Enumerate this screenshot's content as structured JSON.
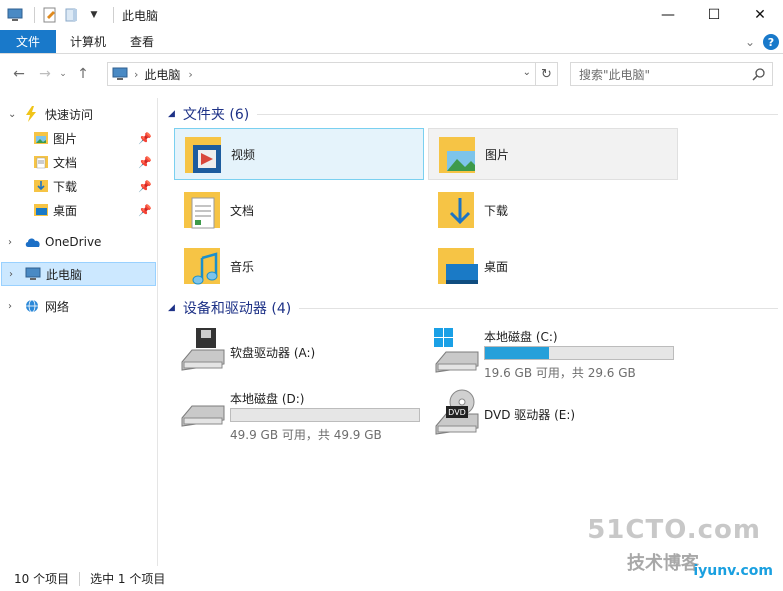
{
  "window": {
    "title": "此电脑",
    "minimize": "—",
    "maximize": "☐",
    "close": "✕"
  },
  "ribbon": {
    "tabs": [
      "文件",
      "计算机",
      "查看"
    ],
    "expand": "⌄",
    "help": "?"
  },
  "address": {
    "location": "此电脑",
    "search_placeholder": "搜索\"此电脑\""
  },
  "sidebar": {
    "quick_access": "快速访问",
    "pinned": [
      "图片",
      "文档",
      "下载",
      "桌面"
    ],
    "onedrive": "OneDrive",
    "this_pc": "此电脑",
    "network": "网络"
  },
  "folders": {
    "header": "文件夹 (6)",
    "items": [
      "视频",
      "图片",
      "文档",
      "下载",
      "音乐",
      "桌面"
    ]
  },
  "drives": {
    "header": "设备和驱动器 (4)",
    "items": [
      {
        "name": "软盘驱动器 (A:)",
        "free": "",
        "used_fraction": null
      },
      {
        "name": "本地磁盘 (C:)",
        "free": "19.6 GB 可用，共 29.6 GB",
        "used_fraction": 0.34
      },
      {
        "name": "本地磁盘 (D:)",
        "free": "49.9 GB 可用，共 49.9 GB",
        "used_fraction": 0.0
      },
      {
        "name": "DVD 驱动器 (E:)",
        "free": "",
        "used_fraction": null
      }
    ]
  },
  "status": {
    "items_count": "10 个项目",
    "selected": "选中 1 个项目"
  },
  "watermark": {
    "site": "51CTO.com",
    "blog": "技术博客",
    "extra": "iyunv.com"
  }
}
